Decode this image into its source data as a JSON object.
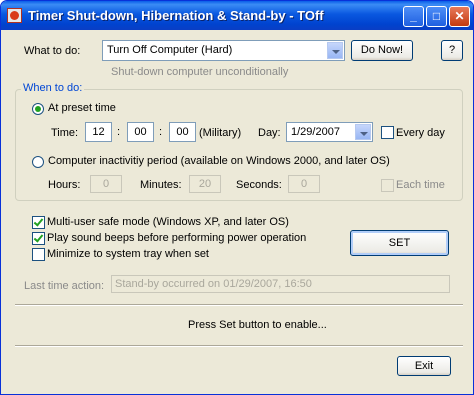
{
  "window": {
    "title": "Timer Shut-down, Hibernation & Stand-by - TOff",
    "minimize_glyph": "_",
    "maximize_glyph": "□",
    "close_glyph": "✕",
    "app_icon": "power-icon"
  },
  "what_to_do": {
    "label": "What to do:",
    "selected": "Turn Off Computer (Hard)",
    "description": "Shut-down computer unconditionally",
    "do_now_label": "Do Now!",
    "help_label": "?"
  },
  "when_to_do": {
    "group_label": "When to do:",
    "preset": {
      "label": "At preset time",
      "selected": true,
      "time_label": "Time:",
      "hour": "12",
      "minute": "00",
      "second": "00",
      "separator": ":",
      "military_label": "(Military)",
      "day_label": "Day:",
      "day_value": "1/29/2007",
      "every_day_label": "Every day",
      "every_day_checked": false
    },
    "inactivity": {
      "label": "Computer inactivitiy period (available on Windows 2000, and later OS)",
      "selected": false,
      "hours_label": "Hours:",
      "hours": "0",
      "minutes_label": "Minutes:",
      "minutes": "20",
      "seconds_label": "Seconds:",
      "seconds": "0",
      "each_time_label": "Each time",
      "each_time_checked": false
    }
  },
  "options": {
    "multi_user_label": "Multi-user safe mode (Windows XP, and later OS)",
    "multi_user_checked": true,
    "beeps_label": "Play sound beeps before performing power operation",
    "beeps_checked": true,
    "tray_label": "Minimize to system tray when set",
    "tray_checked": false,
    "set_label": "SET"
  },
  "last_action": {
    "label": "Last time action:",
    "value": "Stand-by occurred on 01/29/2007, 16:50"
  },
  "status": "Press Set button to enable...",
  "exit_label": "Exit"
}
